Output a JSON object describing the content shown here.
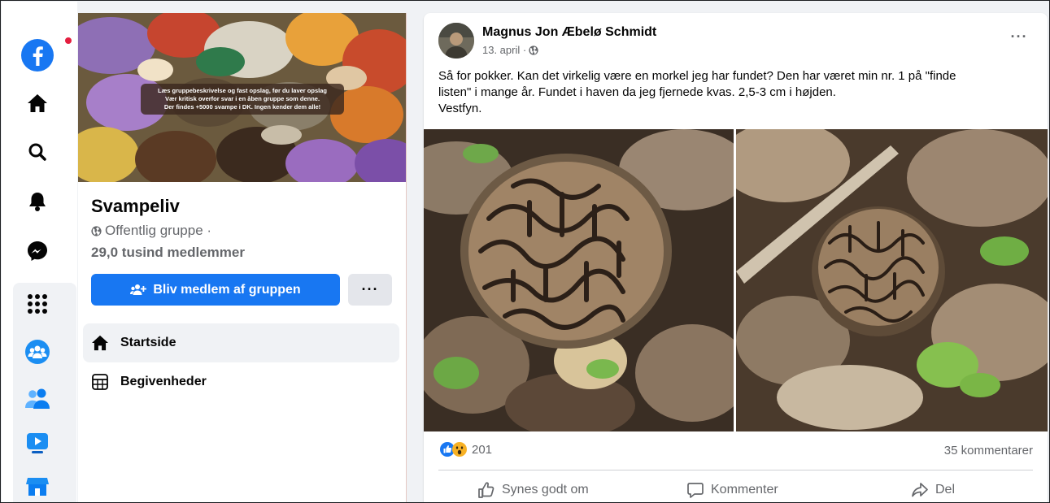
{
  "sidebar": {
    "items": [
      {
        "icon": "facebook-logo-icon",
        "active": false
      },
      {
        "icon": "home-icon"
      },
      {
        "icon": "search-icon"
      },
      {
        "icon": "notifications-bell-icon"
      },
      {
        "icon": "messenger-icon"
      },
      {
        "icon": "menu-grid-icon"
      },
      {
        "icon": "groups-icon"
      },
      {
        "icon": "friends-icon"
      },
      {
        "icon": "watch-icon"
      },
      {
        "icon": "marketplace-icon"
      }
    ],
    "notification_dot_color": "#e41e3f"
  },
  "group": {
    "cover_note_lines": [
      "Læs gruppebeskrivelse og fast opslag, før du laver opslag",
      "Vær kritisk overfor svar i en åben gruppe som denne.",
      "Der findes +5000 svampe i DK. Ingen kender dem alle!"
    ],
    "name": "Svampeliv",
    "privacy": "Offentlig gruppe ·",
    "members": "29,0 tusind medlemmer",
    "join_label": "Bliv medlem af gruppen",
    "more_label": "···",
    "nav": [
      {
        "label": "Startside",
        "icon": "home-icon",
        "active": true
      },
      {
        "label": "Begivenheder",
        "icon": "calendar-icon",
        "active": false
      }
    ]
  },
  "post": {
    "author": "Magnus Jon Æbelø Schmidt",
    "date": "13. april ·",
    "audience_icon": "globe-icon",
    "menu_label": "···",
    "text_lines": [
      "Så for pokker. Kan det virkelig være en morkel jeg har fundet? Den har været min nr. 1 på \"finde",
      "listen\" i mange år. Fundet i haven da jeg fjernede kvas. 2,5-3 cm i højden.",
      "Vestfyn."
    ],
    "photos": [
      {
        "alt": "morel-mushroom-closeup"
      },
      {
        "alt": "morel-mushroom-among-leaves"
      }
    ],
    "reactions": {
      "icons": [
        "like-reaction-icon",
        "wow-reaction-icon"
      ],
      "count": "201"
    },
    "comments_label": "35 kommentarer",
    "actions": [
      {
        "label": "Synes godt om",
        "icon": "thumbs-up-icon"
      },
      {
        "label": "Kommenter",
        "icon": "comment-icon"
      },
      {
        "label": "Del",
        "icon": "share-icon"
      }
    ]
  },
  "colors": {
    "brand_blue": "#1877f2",
    "secondary_text": "#65676b",
    "background": "#f0f2f5"
  }
}
